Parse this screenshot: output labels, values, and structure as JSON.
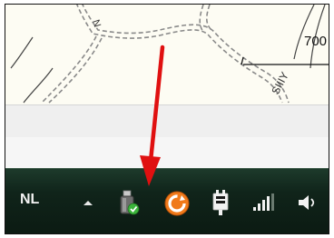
{
  "map": {
    "elevation_label": "700"
  },
  "tray": {
    "language_label": "NL",
    "icons": [
      "show-hidden-icons-chevron-icon",
      "safely-remove-usb-icon",
      "update-icon",
      "power-plug-icon",
      "network-signal-icon",
      "volume-icon"
    ]
  },
  "colors": {
    "taskbar": "#10241a",
    "arrow": "#e01010",
    "update_orange": "#f07a1a",
    "check_green": "#3bb43b"
  }
}
